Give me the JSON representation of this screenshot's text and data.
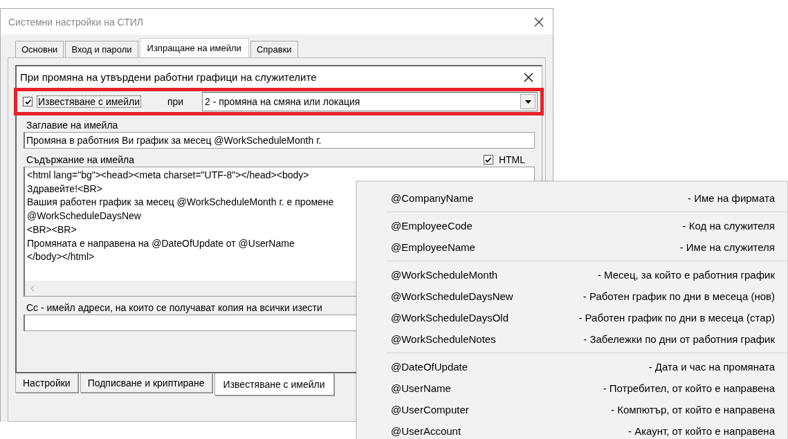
{
  "window": {
    "title": "Системни настройки на СТИЛ"
  },
  "tabs": [
    {
      "label": "Основни",
      "selected": false
    },
    {
      "label": "Вход и пароли",
      "selected": false
    },
    {
      "label": "Изпращане на имейли",
      "selected": true
    },
    {
      "label": "Справки",
      "selected": false
    }
  ],
  "panel": {
    "title": "При промяна на утвърдени работни графици на служителите",
    "notify": {
      "label": "Известяване с имейли",
      "checked": true
    },
    "when_label": "при",
    "when_value": "2 - промяна на смяна или локация",
    "subject_label": "Заглавие на имейла",
    "subject_value": "Промяна в работния Ви график за месец @WorkScheduleMonth г.",
    "body_label": "Съдържание на имейла",
    "html": {
      "label": "HTML",
      "checked": true
    },
    "body_lines": [
      "<html lang=\"bg\"><head><meta charset=\"UTF-8\"></head><body>",
      "Здравейте!<BR>",
      "Вашия работен график за месец @WorkScheduleMonth г. е промене",
      "@WorkScheduleDaysNew",
      "<BR><BR>",
      "Промяната е направена на @DateOfUpdate от @UserName",
      "</body></html>"
    ],
    "cc_label": "Cc - имейл адреси, на които се получават копия на всички изести"
  },
  "bottom_tabs": [
    {
      "label": "Настройки",
      "selected": false
    },
    {
      "label": "Подписване и криптиране",
      "selected": false
    },
    {
      "label": "Известяване с имейли",
      "selected": true
    }
  ],
  "menu": {
    "groups": [
      [
        {
          "name": "@CompanyName",
          "description": "- Име на фирмата"
        }
      ],
      [
        {
          "name": "@EmployeeCode",
          "description": "- Код на служителя"
        },
        {
          "name": "@EmployeeName",
          "description": "- Име на служителя"
        }
      ],
      [
        {
          "name": "@WorkScheduleMonth",
          "description": "- Месец, за който е работния график"
        },
        {
          "name": "@WorkScheduleDaysNew",
          "description": "- Работен график по дни в месеца (нов)"
        },
        {
          "name": "@WorkScheduleDaysOld",
          "description": "- Работен график по дни в месеца (стар)"
        },
        {
          "name": "@WorkScheduleNotes",
          "description": "- Забележки по дни от работния график"
        }
      ],
      [
        {
          "name": "@DateOfUpdate",
          "description": "- Дата и час на промяната"
        },
        {
          "name": "@UserName",
          "description": "- Потребител, от който е направена"
        },
        {
          "name": "@UserComputer",
          "description": "- Компютър, от който е направена"
        },
        {
          "name": "@UserAccount",
          "description": "- Акаунт, от който е направена"
        }
      ]
    ]
  }
}
